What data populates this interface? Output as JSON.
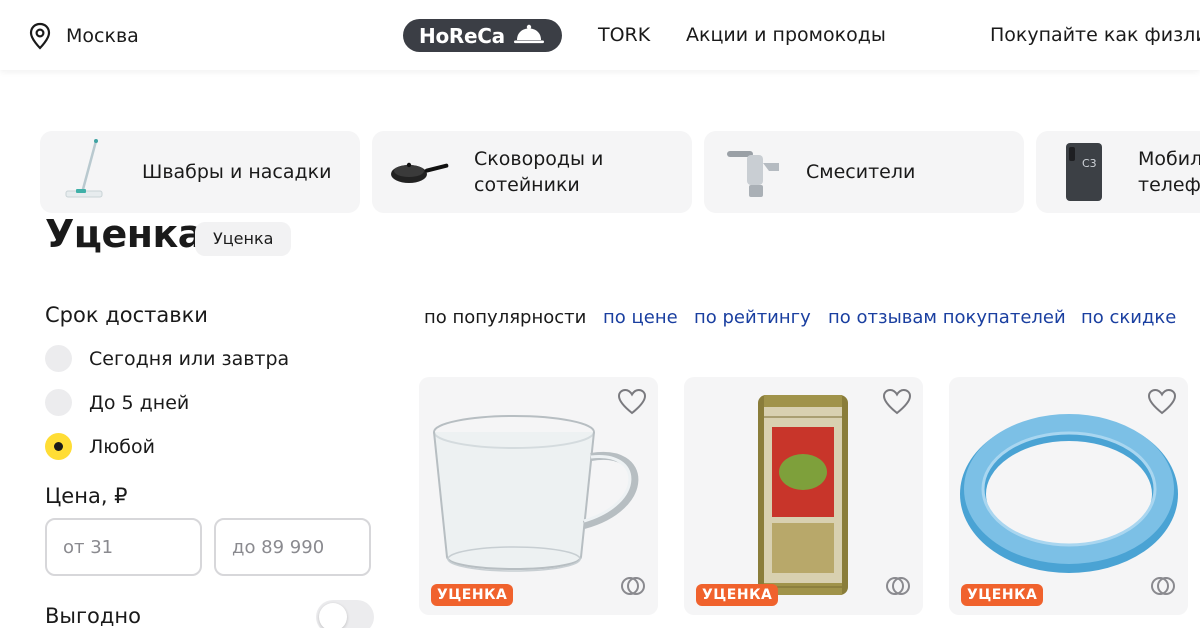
{
  "header": {
    "location": "Москва",
    "horeca_label": "HoReCa",
    "nav": [
      "TORK",
      "Акции и промокоды",
      "Покупайте как физлицо"
    ]
  },
  "categories": [
    {
      "label_line1": "Швабры и насадки",
      "label_line2": "",
      "icon": "mop-icon"
    },
    {
      "label_line1": "Сковороды и",
      "label_line2": "сотейники",
      "icon": "frying-pan-icon"
    },
    {
      "label_line1": "Смесители",
      "label_line2": "",
      "icon": "faucet-icon"
    },
    {
      "label_line1": "Мобильные",
      "label_line2": "телефоны",
      "icon": "phone-icon"
    }
  ],
  "page": {
    "title": "Уценка",
    "title_chip": "Уценка"
  },
  "filters": {
    "delivery_heading": "Срок доставки",
    "delivery_options": [
      {
        "label": "Сегодня или завтра",
        "selected": false
      },
      {
        "label": "До 5 дней",
        "selected": false
      },
      {
        "label": "Любой",
        "selected": true
      }
    ],
    "price_heading": "Цена, ₽",
    "price_from_placeholder": "от 31",
    "price_to_placeholder": "до 89 990",
    "profitable_label": "Выгодно",
    "profitable_on": false
  },
  "sort": {
    "options": [
      "по популярности",
      "по цене",
      "по рейтингу",
      "по отзывам покупателей",
      "по скидке"
    ],
    "active_index": 0
  },
  "products": [
    {
      "badge": "УЦЕНКА",
      "image": "glass-mug"
    },
    {
      "badge": "УЦЕНКА",
      "image": "olive-can"
    },
    {
      "badge": "УЦЕНКА",
      "image": "blue-ring"
    }
  ],
  "colors": {
    "accent_yellow": "#ffdd35",
    "badge_orange": "#f0622d",
    "link_blue": "#1a3fa0",
    "horeca_bg": "#3b3e45"
  }
}
